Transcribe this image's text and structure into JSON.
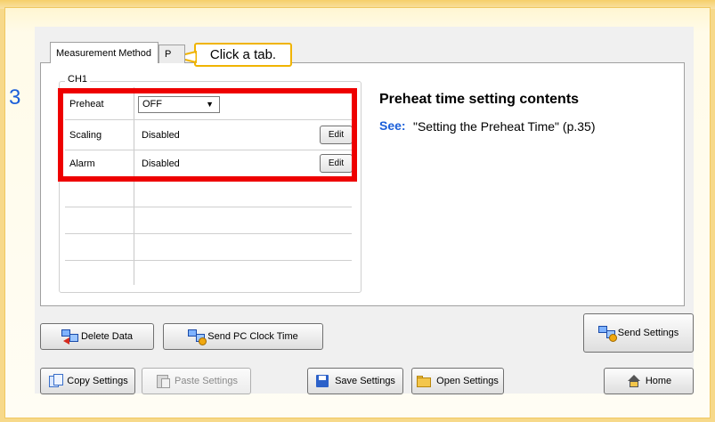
{
  "step_number": "3",
  "callout": "Click a tab.",
  "tabs": [
    {
      "label": "Measurement Method"
    },
    {
      "label": "P"
    }
  ],
  "group": {
    "label": "CH1",
    "rows": [
      {
        "label": "Preheat",
        "value": "OFF",
        "control": "dropdown"
      },
      {
        "label": "Scaling",
        "value": "Disabled",
        "button": "Edit"
      },
      {
        "label": "Alarm",
        "value": "Disabled",
        "button": "Edit"
      }
    ]
  },
  "info": {
    "title": "Preheat time setting contents",
    "see_label": "See:",
    "reference": "\"Setting the Preheat Time\" (p.35)"
  },
  "buttons": {
    "delete_data": "Delete Data",
    "send_pc_clock_time": "Send PC Clock Time",
    "send_settings": "Send Settings",
    "copy_settings": "Copy Settings",
    "paste_settings": "Paste Settings",
    "save_settings": "Save Settings",
    "open_settings": "Open Settings",
    "home": "Home"
  },
  "colors": {
    "highlight": "#ee0000",
    "accent_blue": "#1b5fd9",
    "callout_border": "#f0b400",
    "frame_background": "#f7d98a"
  }
}
